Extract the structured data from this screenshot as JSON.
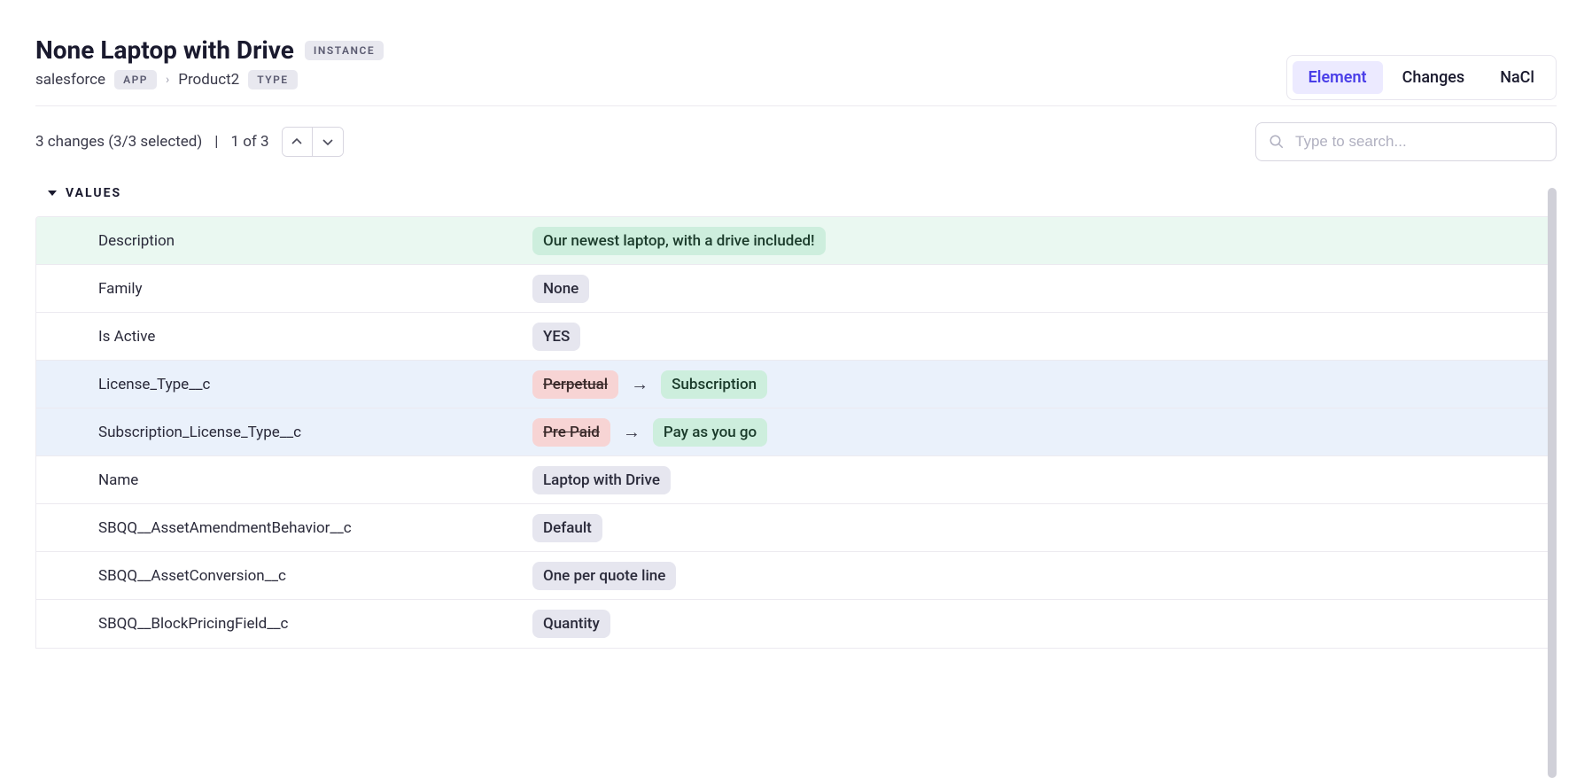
{
  "header": {
    "title": "None Laptop with Drive",
    "instance_badge": "INSTANCE"
  },
  "breadcrumb": {
    "app": "salesforce",
    "app_badge": "APP",
    "type": "Product2",
    "type_badge": "TYPE"
  },
  "tabs": {
    "element": "Element",
    "changes": "Changes",
    "nacl": "NaCl"
  },
  "toolbar": {
    "summary": "3 changes (3/3 selected)",
    "position": "1 of 3",
    "search_placeholder": "Type to search..."
  },
  "section": {
    "values_label": "VALUES"
  },
  "rows": [
    {
      "key": "Description",
      "status": "added",
      "new": "Our newest laptop, with a drive included!"
    },
    {
      "key": "Family",
      "status": "none",
      "value": "None"
    },
    {
      "key": "Is Active",
      "status": "none",
      "value": "YES"
    },
    {
      "key": "License_Type__c",
      "status": "changed",
      "old": "Perpetual",
      "new": "Subscription"
    },
    {
      "key": "Subscription_License_Type__c",
      "status": "changed",
      "old": "Pre Paid",
      "new": "Pay as you go"
    },
    {
      "key": "Name",
      "status": "none",
      "value": "Laptop with Drive"
    },
    {
      "key": "SBQQ__AssetAmendmentBehavior__c",
      "status": "none",
      "value": "Default"
    },
    {
      "key": "SBQQ__AssetConversion__c",
      "status": "none",
      "value": "One per quote line"
    },
    {
      "key": "SBQQ__BlockPricingField__c",
      "status": "none",
      "value": "Quantity"
    }
  ]
}
